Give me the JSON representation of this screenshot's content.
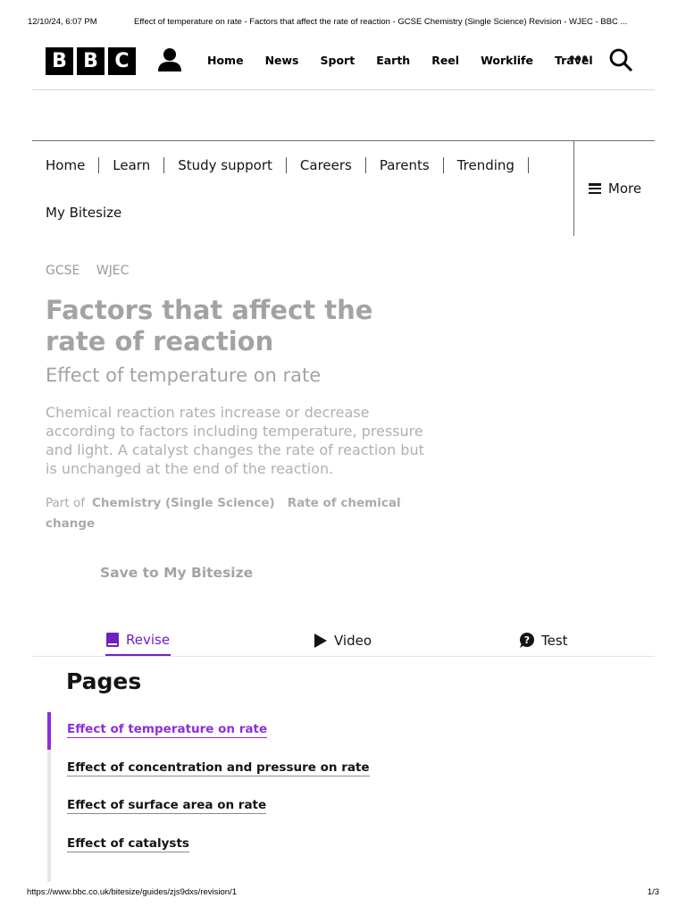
{
  "print_header": {
    "date": "12/10/24, 6:07 PM",
    "title": "Effect of temperature on rate - Factors that affect the rate of reaction - GCSE Chemistry (Single Science) Revision - WJEC - BBC ..."
  },
  "masthead": {
    "logo_letters": [
      "B",
      "B",
      "C"
    ],
    "nav": [
      "Home",
      "News",
      "Sport",
      "Earth",
      "Reel",
      "Worklife",
      "Travel"
    ],
    "more": "•••",
    "icons": {
      "account": "account-icon",
      "search": "search-icon"
    }
  },
  "bitesize_nav": {
    "links": [
      "Home",
      "Learn",
      "Study support",
      "Careers",
      "Parents",
      "Trending",
      "My Bitesize"
    ],
    "more_label": "More"
  },
  "breadcrumb": [
    "GCSE",
    "WJEC"
  ],
  "title": "Factors that affect the rate of reaction",
  "subtitle": "Effect of temperature on rate",
  "summary": "Chemical reaction rates increase or decrease according to factors including temperature, pressure and light. A catalyst changes the rate of reaction but is unchanged at the end of the reaction.",
  "part_of": {
    "label": "Part of",
    "items": [
      "Chemistry (Single Science)",
      "Rate of chemical change"
    ]
  },
  "save_label": "Save to My Bitesize",
  "tabs": [
    {
      "label": "Revise",
      "active": true
    },
    {
      "label": "Video",
      "active": false
    },
    {
      "label": "Test",
      "active": false
    }
  ],
  "pages": {
    "heading": "Pages",
    "items": [
      "Effect of temperature on rate",
      "Effect of concentration and pressure on rate",
      "Effect of surface area on rate",
      "Effect of catalysts"
    ]
  },
  "print_footer": {
    "url": "https://www.bbc.co.uk/bitesize/guides/zjs9dxs/revision/1",
    "page": "1/3"
  },
  "colors": {
    "accent": "#8c2ee0",
    "text": "#141414",
    "muted": "#a3a3a3"
  }
}
